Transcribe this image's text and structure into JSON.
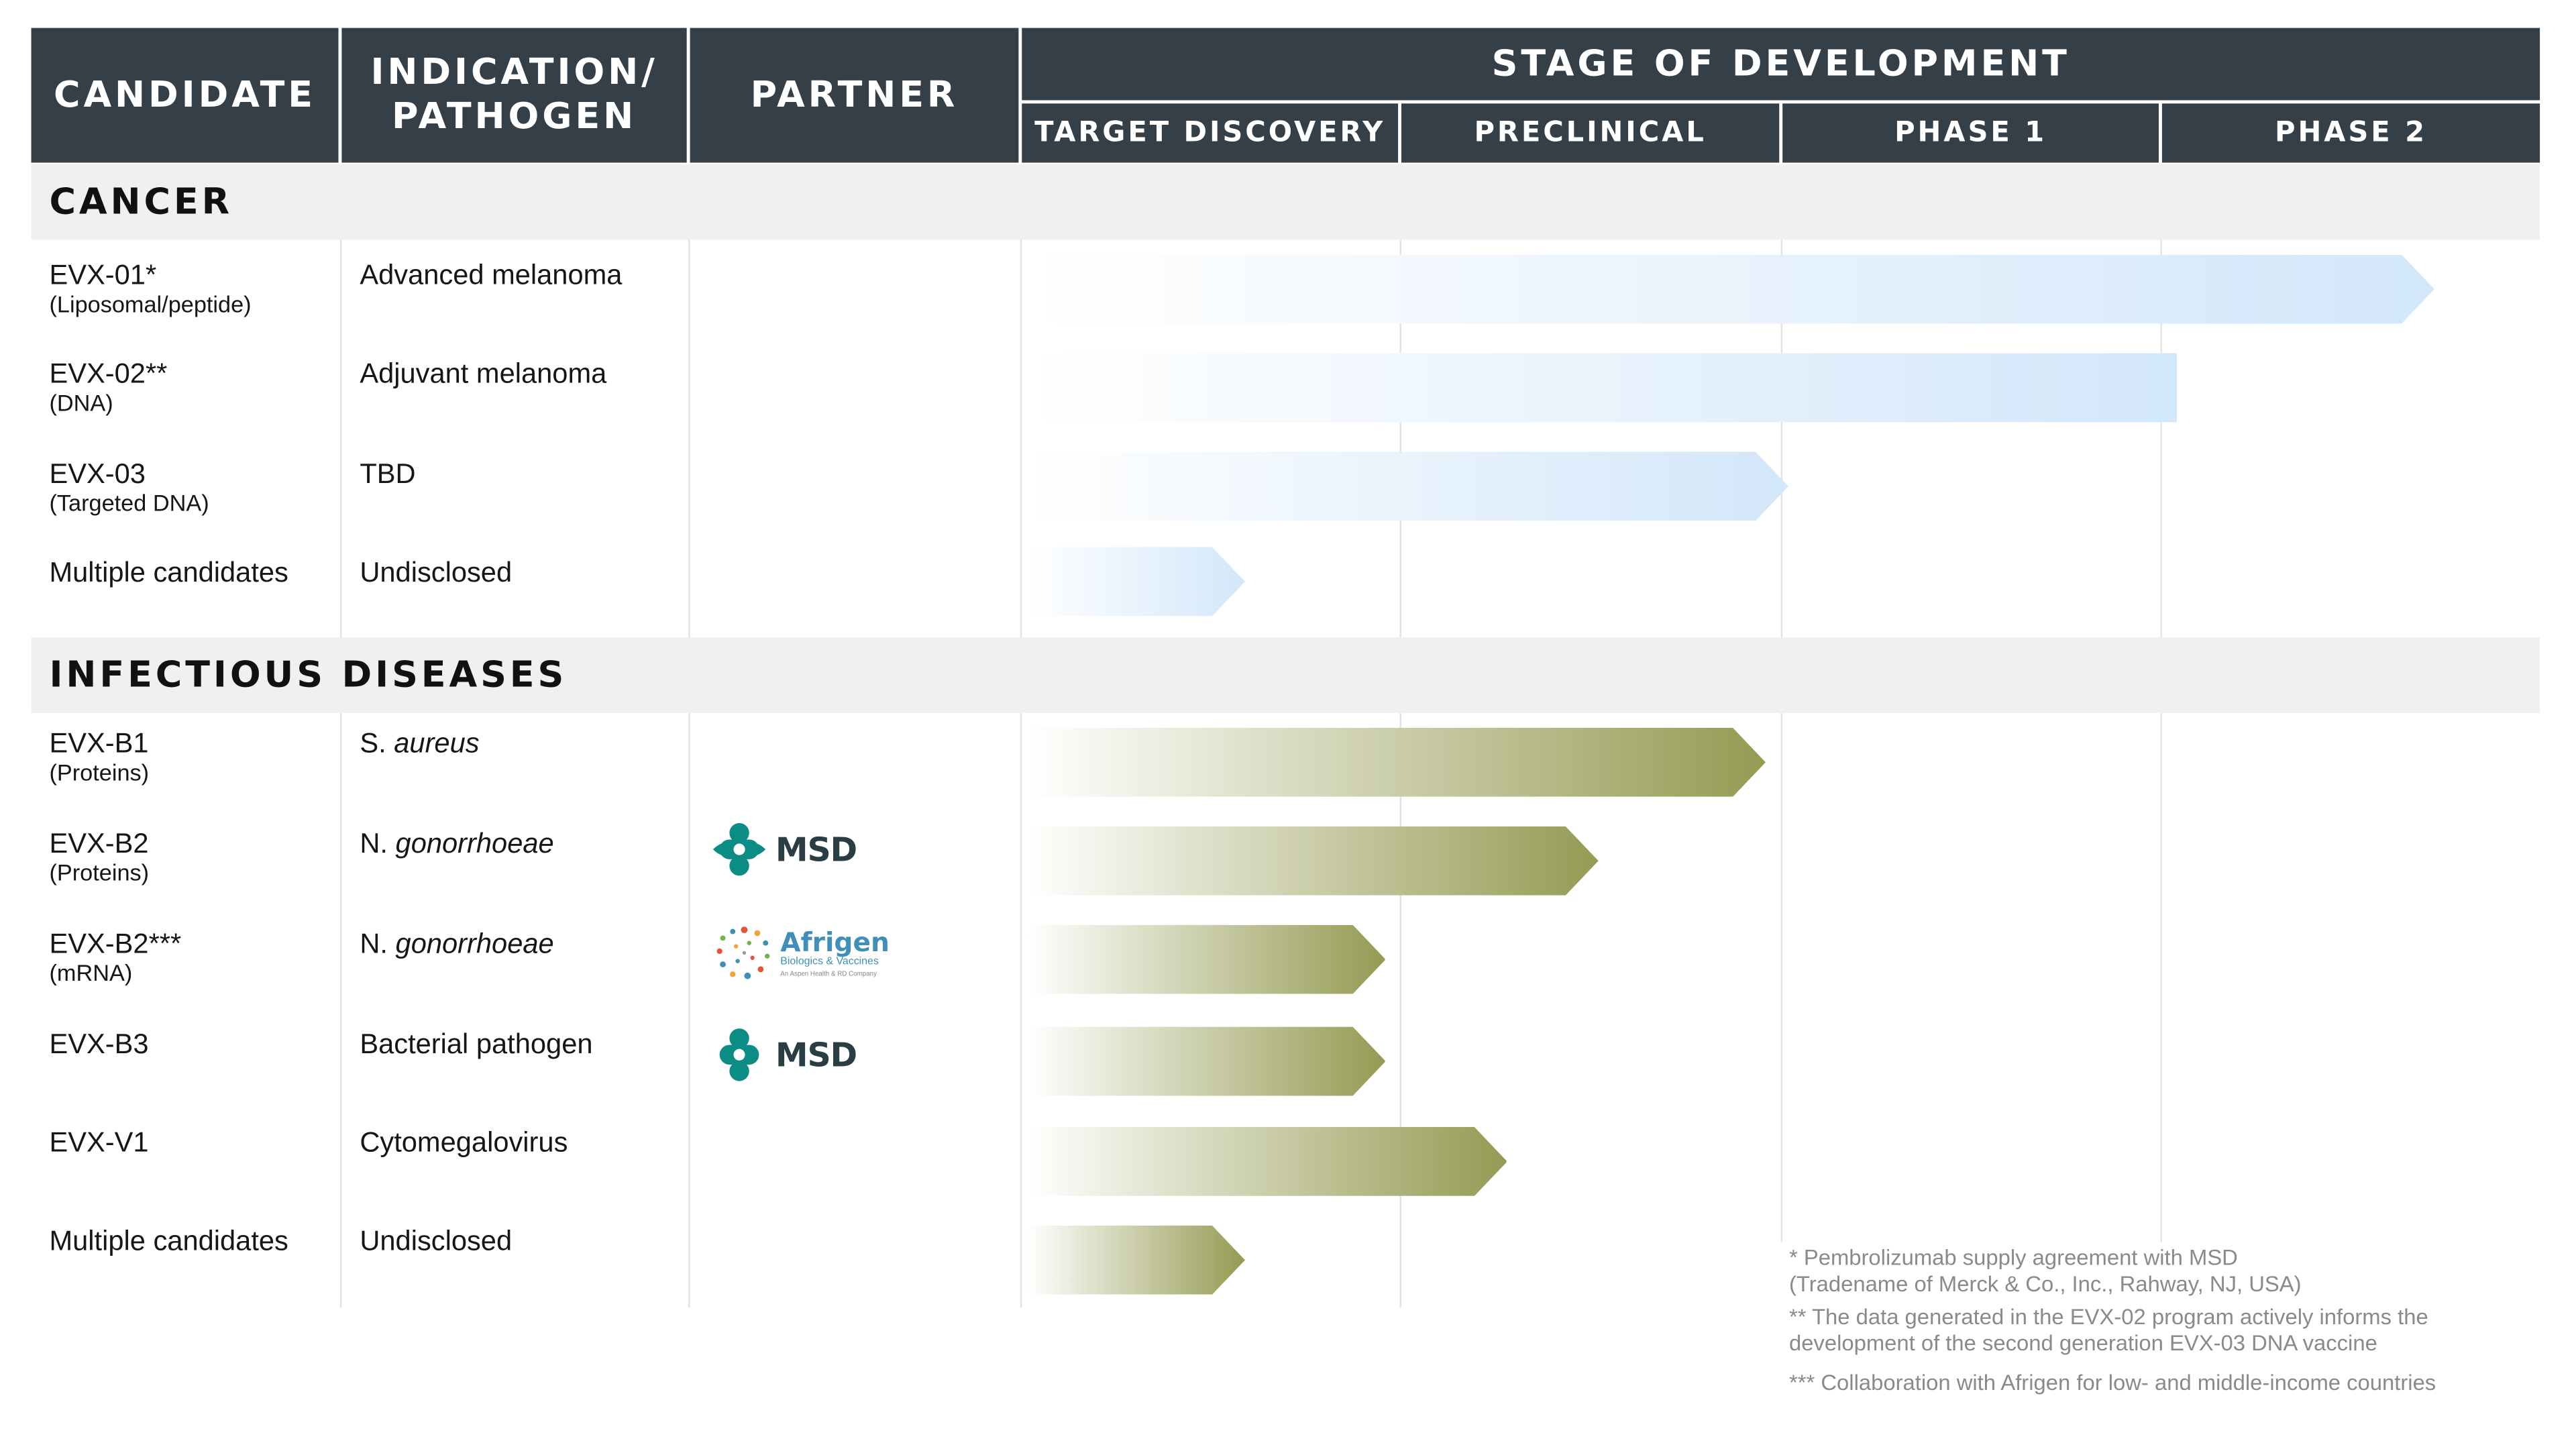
{
  "header": {
    "candidate": "CANDIDATE",
    "indication": "INDICATION/ PATHOGEN",
    "partner": "PARTNER",
    "stage": "STAGE OF DEVELOPMENT",
    "stages": [
      "TARGET DISCOVERY",
      "PRECLINICAL",
      "PHASE 1",
      "PHASE 2"
    ]
  },
  "sections": [
    {
      "title": "CANCER",
      "rows": [
        {
          "name": "EVX-01*",
          "sub": "(Liposomal/peptide)",
          "indication": "Advanced melanoma",
          "indication_italic": "",
          "partner": "",
          "progress": 3.7,
          "arrow": true
        },
        {
          "name": "EVX-02**",
          "sub": "(DNA)",
          "indication": "Adjuvant melanoma",
          "indication_italic": "",
          "partner": "",
          "progress": 3.0,
          "arrow": false
        },
        {
          "name": "EVX-03",
          "sub": "(Targeted DNA)",
          "indication": "TBD",
          "indication_italic": "",
          "partner": "",
          "progress": 2.0,
          "arrow": true
        },
        {
          "name": "Multiple candidates",
          "sub": "",
          "indication": "Undisclosed",
          "indication_italic": "",
          "partner": "",
          "progress": 0.57,
          "arrow": true
        }
      ]
    },
    {
      "title": "INFECTIOUS DISEASES",
      "rows": [
        {
          "name": "EVX-B1",
          "sub": "(Proteins)",
          "indication": "S. ",
          "indication_italic": "aureus",
          "partner": "",
          "progress": 1.94,
          "arrow": true
        },
        {
          "name": "EVX-B2",
          "sub": "(Proteins)",
          "indication": "N. ",
          "indication_italic": "gonorrhoeae",
          "partner": "MSD",
          "progress": 1.5,
          "arrow": true
        },
        {
          "name": "EVX-B2***",
          "sub": "(mRNA)",
          "indication": "N. ",
          "indication_italic": "gonorrhoeae",
          "partner": "Afrigen",
          "progress": 0.94,
          "arrow": true
        },
        {
          "name": "EVX-B3",
          "sub": "",
          "indication": "Bacterial pathogen",
          "indication_italic": "",
          "partner": "MSD",
          "progress": 0.94,
          "arrow": true
        },
        {
          "name": "EVX-V1",
          "sub": "",
          "indication": "Cytomegalovirus",
          "indication_italic": "",
          "partner": "",
          "progress": 1.26,
          "arrow": true
        },
        {
          "name": "Multiple candidates",
          "sub": "",
          "indication": "Undisclosed",
          "indication_italic": "",
          "partner": "",
          "progress": 0.57,
          "arrow": true
        }
      ]
    }
  ],
  "partners": {
    "msd": {
      "label": "MSD"
    },
    "afrigen": {
      "label": "Afrigen",
      "subtitle": "Biologics & Vaccines",
      "tagline": "An Aspen Health & RD Company"
    }
  },
  "footnotes": [
    "* Pembrolizumab supply agreement with MSD (Tradename of Merck & Co., Inc., Rahway, NJ, USA)",
    "** The data generated in the EVX-02 program actively informs  the development of the second generation EVX-03 DNA vaccine",
    "*** Collaboration with Afrigen for low- and middle-income countries"
  ],
  "colors": {
    "header": "#343f48",
    "cancer_bar": "#d2e7fa",
    "infectious_bar": "#959b53",
    "section_bg": "#f0f0f0"
  }
}
